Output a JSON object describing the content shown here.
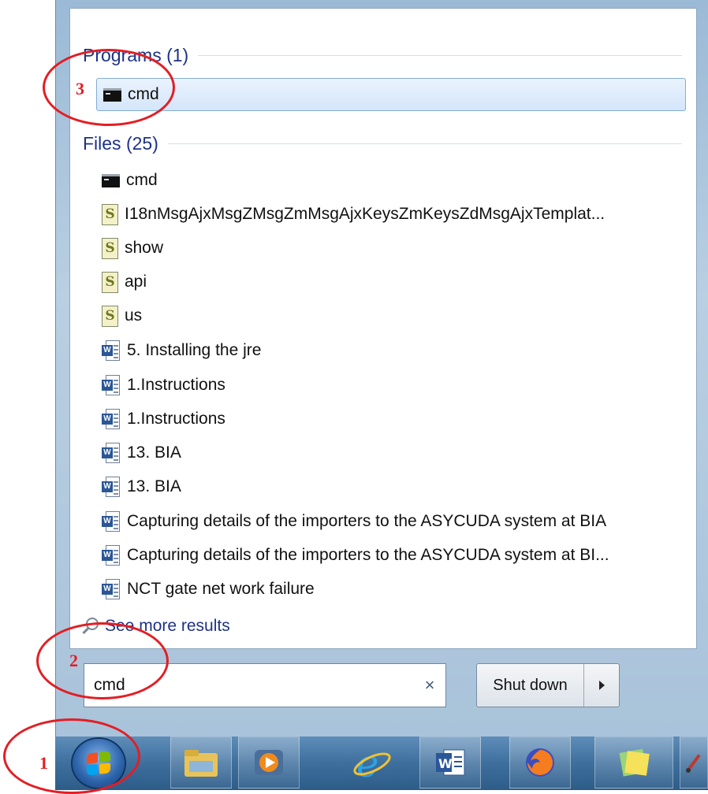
{
  "start_menu": {
    "programs_header": "Programs (1)",
    "program_result": "cmd",
    "files_header": "Files (25)",
    "files": [
      {
        "label": "cmd",
        "icon": "cmd-icon"
      },
      {
        "label": "I18nMsgAjxMsgZMsgZmMsgAjxKeysZmKeysZdMsgAjxTemplat...",
        "icon": "script-icon"
      },
      {
        "label": "show",
        "icon": "script-icon"
      },
      {
        "label": "api",
        "icon": "script-icon"
      },
      {
        "label": "us",
        "icon": "script-icon"
      },
      {
        "label": "5. Installing the jre",
        "icon": "word-doc-icon"
      },
      {
        "label": "1.Instructions",
        "icon": "word-doc-icon"
      },
      {
        "label": "1.Instructions",
        "icon": "word-doc-icon"
      },
      {
        "label": "13. BIA",
        "icon": "word-doc-icon"
      },
      {
        "label": "13. BIA",
        "icon": "word-doc-icon"
      },
      {
        "label": "Capturing details of the importers to the ASYCUDA system at BIA",
        "icon": "word-doc-icon"
      },
      {
        "label": "Capturing details of the importers to the ASYCUDA system at BI...",
        "icon": "word-doc-icon"
      },
      {
        "label": "NCT gate net work failure",
        "icon": "word-doc-icon"
      }
    ],
    "see_more": "See more results",
    "search": {
      "value": "cmd",
      "clear_icon": "close-icon"
    },
    "shutdown_label": "Shut down"
  },
  "taskbar": {
    "icons": [
      "start-orb-icon",
      "file-explorer-icon",
      "media-player-icon",
      "internet-explorer-icon",
      "word-icon",
      "firefox-icon",
      "sticky-notes-icon",
      "paint-icon"
    ]
  },
  "annotations": {
    "step1": "1",
    "step2": "2",
    "step3": "3",
    "color": "#e31e24"
  }
}
